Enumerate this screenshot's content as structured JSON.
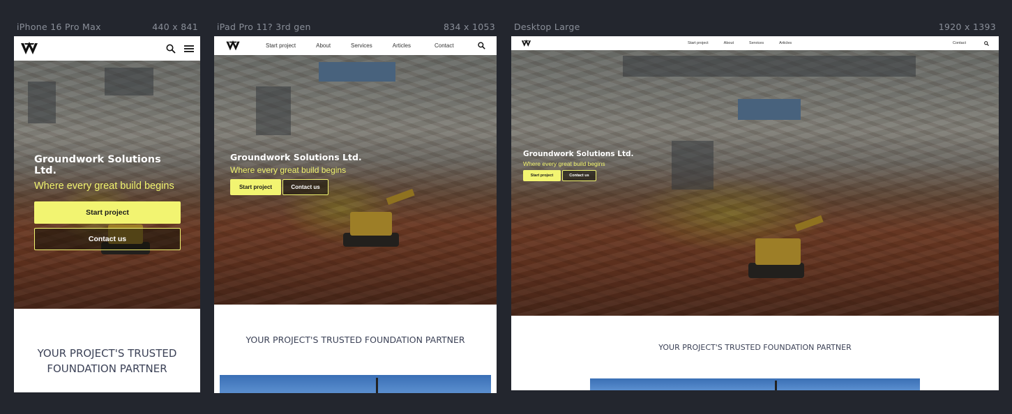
{
  "devices": [
    {
      "name": "iPhone 16 Pro Max",
      "size": "440 x 841"
    },
    {
      "name": "iPad Pro 11? 3rd gen",
      "size": "834 x 1053"
    },
    {
      "name": "Desktop Large",
      "size": "1920 x 1393"
    }
  ],
  "site": {
    "company": "Groundwork Solutions Ltd.",
    "tagline": "Where every great build begins",
    "cta_primary": "Start project",
    "cta_secondary": "Contact us",
    "section_title": "YOUR PROJECT'S TRUSTED FOUNDATION PARTNER",
    "section_title_line1": "YOUR PROJECT'S TRUSTED",
    "section_title_line2": "FOUNDATION PARTNER",
    "nav": {
      "start_project": "Start project",
      "about": "About",
      "services": "Services",
      "articles": "Articles",
      "contact": "Contact"
    }
  },
  "colors": {
    "background": "#23262e",
    "accent": "#f2f471",
    "heading": "#3c4257"
  },
  "icons": [
    "logo-icon",
    "search-icon",
    "menu-icon"
  ]
}
